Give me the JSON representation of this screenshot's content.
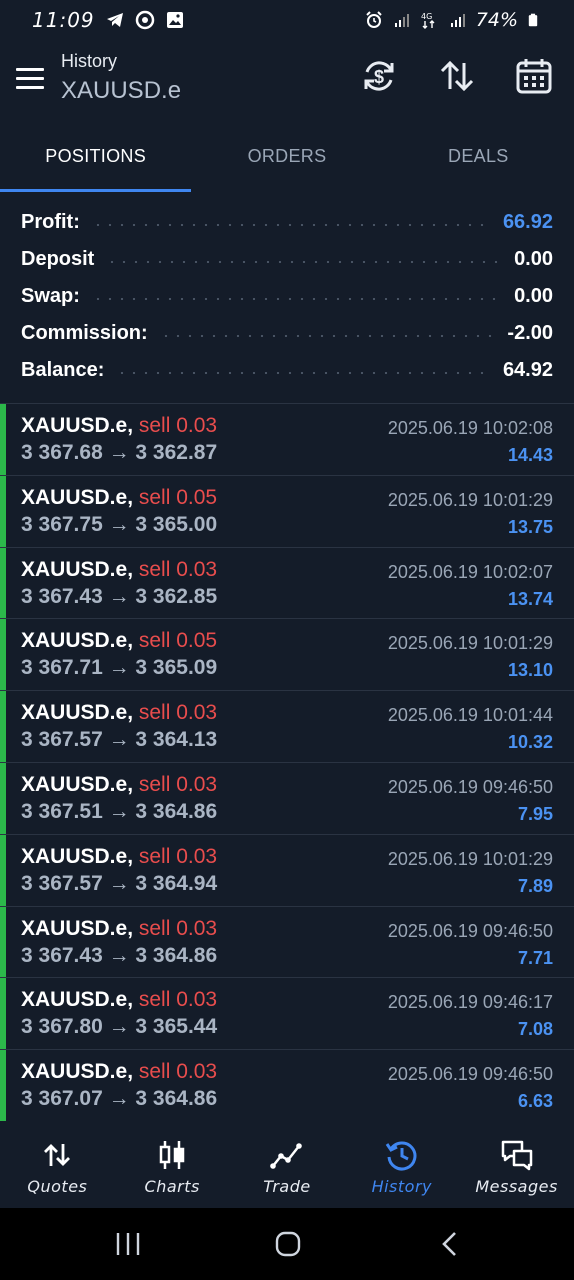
{
  "status_bar": {
    "time": "11:09",
    "battery": "74%"
  },
  "header": {
    "subtitle": "History",
    "symbol": "XAUUSD.e"
  },
  "tabs": [
    {
      "label": "POSITIONS",
      "active": true
    },
    {
      "label": "ORDERS",
      "active": false
    },
    {
      "label": "DEALS",
      "active": false
    }
  ],
  "summary": [
    {
      "label": "Profit:",
      "value": "66.92"
    },
    {
      "label": "Deposit",
      "value": "0.00"
    },
    {
      "label": "Swap:",
      "value": "0.00"
    },
    {
      "label": "Commission:",
      "value": "-2.00"
    },
    {
      "label": "Balance:",
      "value": "64.92"
    }
  ],
  "positions": [
    {
      "symbol": "XAUUSD.e,",
      "side": "sell 0.03",
      "prices": "3 367.68 → 3 362.87",
      "time": "2025.06.19 10:02:08",
      "profit": "14.43"
    },
    {
      "symbol": "XAUUSD.e,",
      "side": "sell 0.05",
      "prices": "3 367.75 → 3 365.00",
      "time": "2025.06.19 10:01:29",
      "profit": "13.75"
    },
    {
      "symbol": "XAUUSD.e,",
      "side": "sell 0.03",
      "prices": "3 367.43 → 3 362.85",
      "time": "2025.06.19 10:02:07",
      "profit": "13.74"
    },
    {
      "symbol": "XAUUSD.e,",
      "side": "sell 0.05",
      "prices": "3 367.71 → 3 365.09",
      "time": "2025.06.19 10:01:29",
      "profit": "13.10"
    },
    {
      "symbol": "XAUUSD.e,",
      "side": "sell 0.03",
      "prices": "3 367.57 → 3 364.13",
      "time": "2025.06.19 10:01:44",
      "profit": "10.32"
    },
    {
      "symbol": "XAUUSD.e,",
      "side": "sell 0.03",
      "prices": "3 367.51 → 3 364.86",
      "time": "2025.06.19 09:46:50",
      "profit": "7.95"
    },
    {
      "symbol": "XAUUSD.e,",
      "side": "sell 0.03",
      "prices": "3 367.57 → 3 364.94",
      "time": "2025.06.19 10:01:29",
      "profit": "7.89"
    },
    {
      "symbol": "XAUUSD.e,",
      "side": "sell 0.03",
      "prices": "3 367.43 → 3 364.86",
      "time": "2025.06.19 09:46:50",
      "profit": "7.71"
    },
    {
      "symbol": "XAUUSD.e,",
      "side": "sell 0.03",
      "prices": "3 367.80 → 3 365.44",
      "time": "2025.06.19 09:46:17",
      "profit": "7.08"
    },
    {
      "symbol": "XAUUSD.e,",
      "side": "sell 0.03",
      "prices": "3 367.07 → 3 364.86",
      "time": "2025.06.19 09:46:50",
      "profit": "6.63"
    }
  ],
  "bottom_nav": [
    {
      "label": "Quotes",
      "icon": "quotes-icon",
      "active": false
    },
    {
      "label": "Charts",
      "icon": "charts-icon",
      "active": false
    },
    {
      "label": "Trade",
      "icon": "trade-icon",
      "active": false
    },
    {
      "label": "History",
      "icon": "history-icon",
      "active": true
    },
    {
      "label": "Messages",
      "icon": "messages-icon",
      "active": false
    }
  ],
  "colors": {
    "background": "#141c29",
    "accent": "#3f86f0",
    "profit": "#4b92f2",
    "sell": "#e84d4d",
    "position_bar": "#2cb84a"
  }
}
